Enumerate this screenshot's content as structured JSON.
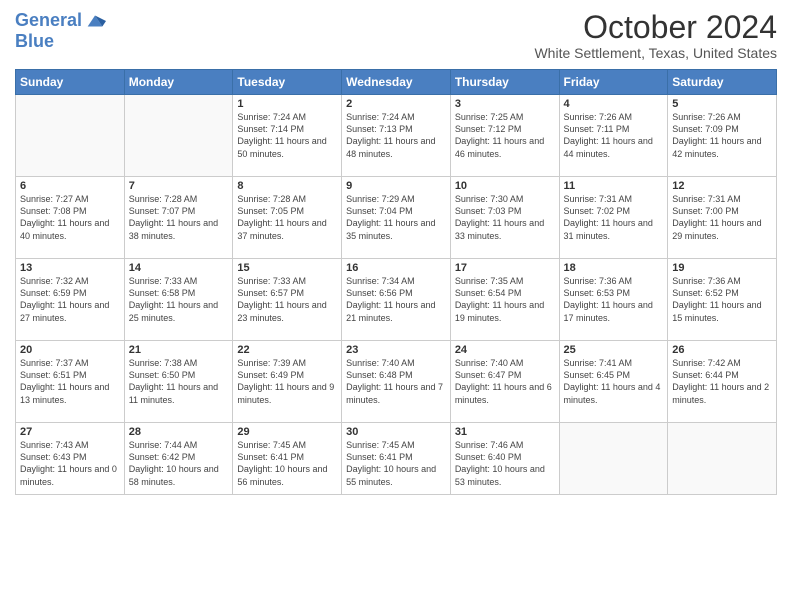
{
  "header": {
    "logo_line1": "General",
    "logo_line2": "Blue",
    "month_title": "October 2024",
    "subtitle": "White Settlement, Texas, United States"
  },
  "days_of_week": [
    "Sunday",
    "Monday",
    "Tuesday",
    "Wednesday",
    "Thursday",
    "Friday",
    "Saturday"
  ],
  "weeks": [
    [
      {
        "day": "",
        "info": ""
      },
      {
        "day": "",
        "info": ""
      },
      {
        "day": "1",
        "info": "Sunrise: 7:24 AM\nSunset: 7:14 PM\nDaylight: 11 hours and 50 minutes."
      },
      {
        "day": "2",
        "info": "Sunrise: 7:24 AM\nSunset: 7:13 PM\nDaylight: 11 hours and 48 minutes."
      },
      {
        "day": "3",
        "info": "Sunrise: 7:25 AM\nSunset: 7:12 PM\nDaylight: 11 hours and 46 minutes."
      },
      {
        "day": "4",
        "info": "Sunrise: 7:26 AM\nSunset: 7:11 PM\nDaylight: 11 hours and 44 minutes."
      },
      {
        "day": "5",
        "info": "Sunrise: 7:26 AM\nSunset: 7:09 PM\nDaylight: 11 hours and 42 minutes."
      }
    ],
    [
      {
        "day": "6",
        "info": "Sunrise: 7:27 AM\nSunset: 7:08 PM\nDaylight: 11 hours and 40 minutes."
      },
      {
        "day": "7",
        "info": "Sunrise: 7:28 AM\nSunset: 7:07 PM\nDaylight: 11 hours and 38 minutes."
      },
      {
        "day": "8",
        "info": "Sunrise: 7:28 AM\nSunset: 7:05 PM\nDaylight: 11 hours and 37 minutes."
      },
      {
        "day": "9",
        "info": "Sunrise: 7:29 AM\nSunset: 7:04 PM\nDaylight: 11 hours and 35 minutes."
      },
      {
        "day": "10",
        "info": "Sunrise: 7:30 AM\nSunset: 7:03 PM\nDaylight: 11 hours and 33 minutes."
      },
      {
        "day": "11",
        "info": "Sunrise: 7:31 AM\nSunset: 7:02 PM\nDaylight: 11 hours and 31 minutes."
      },
      {
        "day": "12",
        "info": "Sunrise: 7:31 AM\nSunset: 7:00 PM\nDaylight: 11 hours and 29 minutes."
      }
    ],
    [
      {
        "day": "13",
        "info": "Sunrise: 7:32 AM\nSunset: 6:59 PM\nDaylight: 11 hours and 27 minutes."
      },
      {
        "day": "14",
        "info": "Sunrise: 7:33 AM\nSunset: 6:58 PM\nDaylight: 11 hours and 25 minutes."
      },
      {
        "day": "15",
        "info": "Sunrise: 7:33 AM\nSunset: 6:57 PM\nDaylight: 11 hours and 23 minutes."
      },
      {
        "day": "16",
        "info": "Sunrise: 7:34 AM\nSunset: 6:56 PM\nDaylight: 11 hours and 21 minutes."
      },
      {
        "day": "17",
        "info": "Sunrise: 7:35 AM\nSunset: 6:54 PM\nDaylight: 11 hours and 19 minutes."
      },
      {
        "day": "18",
        "info": "Sunrise: 7:36 AM\nSunset: 6:53 PM\nDaylight: 11 hours and 17 minutes."
      },
      {
        "day": "19",
        "info": "Sunrise: 7:36 AM\nSunset: 6:52 PM\nDaylight: 11 hours and 15 minutes."
      }
    ],
    [
      {
        "day": "20",
        "info": "Sunrise: 7:37 AM\nSunset: 6:51 PM\nDaylight: 11 hours and 13 minutes."
      },
      {
        "day": "21",
        "info": "Sunrise: 7:38 AM\nSunset: 6:50 PM\nDaylight: 11 hours and 11 minutes."
      },
      {
        "day": "22",
        "info": "Sunrise: 7:39 AM\nSunset: 6:49 PM\nDaylight: 11 hours and 9 minutes."
      },
      {
        "day": "23",
        "info": "Sunrise: 7:40 AM\nSunset: 6:48 PM\nDaylight: 11 hours and 7 minutes."
      },
      {
        "day": "24",
        "info": "Sunrise: 7:40 AM\nSunset: 6:47 PM\nDaylight: 11 hours and 6 minutes."
      },
      {
        "day": "25",
        "info": "Sunrise: 7:41 AM\nSunset: 6:45 PM\nDaylight: 11 hours and 4 minutes."
      },
      {
        "day": "26",
        "info": "Sunrise: 7:42 AM\nSunset: 6:44 PM\nDaylight: 11 hours and 2 minutes."
      }
    ],
    [
      {
        "day": "27",
        "info": "Sunrise: 7:43 AM\nSunset: 6:43 PM\nDaylight: 11 hours and 0 minutes."
      },
      {
        "day": "28",
        "info": "Sunrise: 7:44 AM\nSunset: 6:42 PM\nDaylight: 10 hours and 58 minutes."
      },
      {
        "day": "29",
        "info": "Sunrise: 7:45 AM\nSunset: 6:41 PM\nDaylight: 10 hours and 56 minutes."
      },
      {
        "day": "30",
        "info": "Sunrise: 7:45 AM\nSunset: 6:41 PM\nDaylight: 10 hours and 55 minutes."
      },
      {
        "day": "31",
        "info": "Sunrise: 7:46 AM\nSunset: 6:40 PM\nDaylight: 10 hours and 53 minutes."
      },
      {
        "day": "",
        "info": ""
      },
      {
        "day": "",
        "info": ""
      }
    ]
  ]
}
